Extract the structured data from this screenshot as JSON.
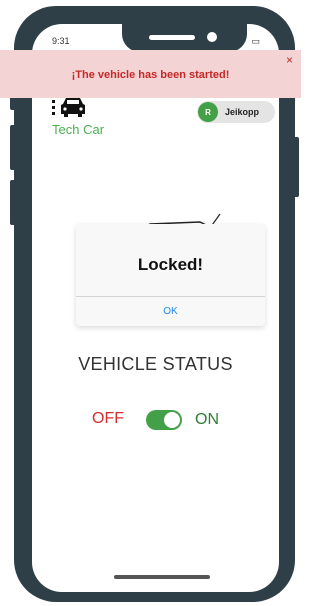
{
  "status_bar": {
    "time": "9:31",
    "icons_text": ".ıl ⌔ ▭"
  },
  "app": {
    "logo_text": "Tech Car",
    "logo_icon": "car-icon",
    "brand_color": "#4caf50"
  },
  "user": {
    "initial": "R",
    "name": "Jeikopp"
  },
  "toast": {
    "message": "¡The vehicle has been started!",
    "close_label": "×",
    "background": "#f3d3d4",
    "text_color": "#c62828"
  },
  "modal": {
    "title": "Locked!",
    "ok_label": "OK"
  },
  "vehicle": {
    "status_label": "VEHICLE STATUS",
    "off_label": "OFF",
    "on_label": "ON",
    "power_on": true
  }
}
